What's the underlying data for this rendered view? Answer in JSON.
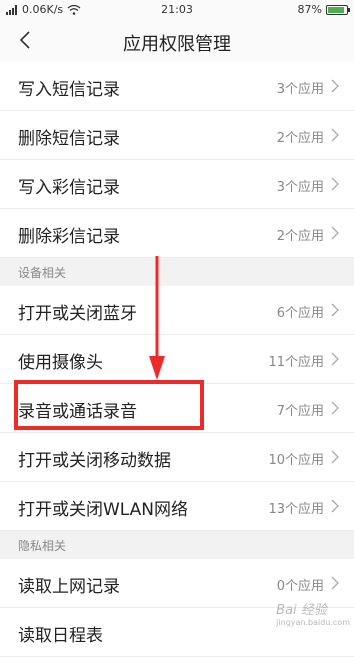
{
  "status_bar": {
    "network": "0.06K/s",
    "time": "21:03",
    "battery": "87%",
    "battery_level": 0.87
  },
  "header": {
    "title": "应用权限管理"
  },
  "items_group1": [
    {
      "label": "写入短信记录",
      "count": "3个应用"
    },
    {
      "label": "删除短信记录",
      "count": "2个应用"
    },
    {
      "label": "写入彩信记录",
      "count": "3个应用"
    },
    {
      "label": "删除彩信记录",
      "count": "2个应用"
    }
  ],
  "section_device": "设备相关",
  "items_device": [
    {
      "label": "打开或关闭蓝牙",
      "count": "6个应用"
    },
    {
      "label": "使用摄像头",
      "count": "11个应用"
    },
    {
      "label": "录音或通话录音",
      "count": "7个应用"
    },
    {
      "label": "打开或关闭移动数据",
      "count": "10个应用"
    },
    {
      "label": "打开或关闭WLAN网络",
      "count": "13个应用"
    }
  ],
  "section_privacy": "隐私相关",
  "items_privacy": [
    {
      "label": "读取上网记录",
      "count": "0个应用"
    },
    {
      "label": "读取日程表",
      "count": ""
    }
  ],
  "watermark": {
    "brand": "Bai 经验",
    "url": "jingyan.baidu.com"
  },
  "colors": {
    "highlight": "#ee2b2b",
    "battery": "#4caf50"
  },
  "icons": [
    "back-arrow-icon",
    "chevron-right-icon",
    "wifi-icon",
    "signal-icon",
    "battery-icon",
    "down-arrow-annotation"
  ]
}
